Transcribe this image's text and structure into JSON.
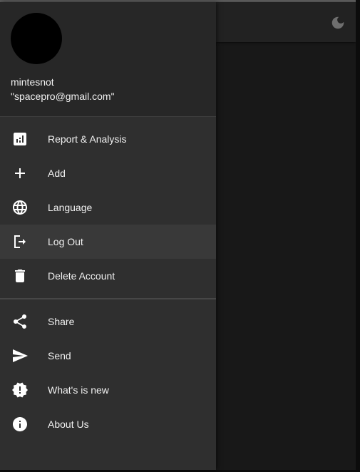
{
  "user": {
    "name": "mintesnot",
    "email": "\"spacepro@gmail.com\""
  },
  "theme_toggle": {
    "icon": "moon-icon"
  },
  "menu_primary": [
    {
      "label": "Report & Analysis",
      "icon": "report-chart-icon"
    },
    {
      "label": "Add",
      "icon": "plus-icon"
    },
    {
      "label": "Language",
      "icon": "globe-icon"
    },
    {
      "label": "Log Out",
      "icon": "logout-icon"
    },
    {
      "label": "Delete Account",
      "icon": "trash-icon"
    }
  ],
  "menu_secondary": [
    {
      "label": "Share",
      "icon": "share-icon"
    },
    {
      "label": "Send",
      "icon": "send-icon"
    },
    {
      "label": "What's is new",
      "icon": "new-badge-icon"
    },
    {
      "label": "About Us",
      "icon": "info-icon"
    }
  ],
  "colors": {
    "drawer": "#2f2f2f",
    "header": "#272727",
    "selected_item": "#393939",
    "text": "#f0f0f0"
  }
}
